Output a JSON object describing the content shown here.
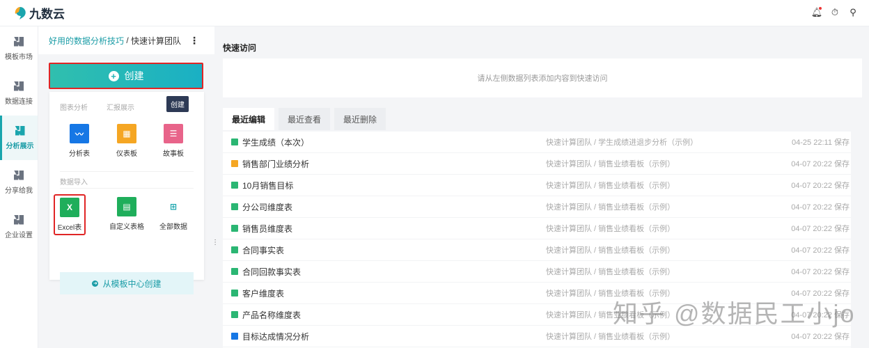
{
  "app": {
    "name": "九数云"
  },
  "header": {
    "icons": [
      "bell-icon",
      "timer-icon",
      "user-icon"
    ]
  },
  "nav": [
    {
      "label": "模板市场"
    },
    {
      "label": "数据连接"
    },
    {
      "label": "分析展示",
      "active": true
    },
    {
      "label": "分享给我"
    },
    {
      "label": "企业设置"
    }
  ],
  "panel": {
    "breadcrumb": {
      "parent": "好用的数据分析技巧",
      "sep": " / ",
      "current": "快速计算团队"
    },
    "create_label": "创建",
    "tooltip": "创建",
    "sections": {
      "chart": "图表分析",
      "report": "汇报展示",
      "import": "数据导入"
    },
    "tiles": [
      {
        "label": "分析表",
        "color": "#1677e5"
      },
      {
        "label": "仪表板",
        "color": "#f5a623"
      },
      {
        "label": "故事板",
        "color": "#e8648a"
      }
    ],
    "import_tiles": [
      {
        "label": "Excel表",
        "icon_text": "X"
      },
      {
        "label": "自定义表格"
      },
      {
        "label": "全部数据"
      }
    ],
    "template_button": "从模板中心创建"
  },
  "main": {
    "quick_title": "快速访问",
    "quick_placeholder": "请从左侧数据列表添加内容到快速访问",
    "tabs": [
      "最近编辑",
      "最近查看",
      "最近删除"
    ],
    "rows": [
      {
        "name": "学生成绩（本次）",
        "path": "快速计算团队 / 学生成绩进退步分析（示例）",
        "time": "04-25 22:11 保存",
        "type": "table"
      },
      {
        "name": "销售部门业绩分析",
        "path": "快速计算团队 / 销售业绩看板（示例）",
        "time": "04-07 20:22 保存",
        "type": "dashboard"
      },
      {
        "name": "10月销售目标",
        "path": "快速计算团队 / 销售业绩看板（示例）",
        "time": "04-07 20:22 保存",
        "type": "table"
      },
      {
        "name": "分公司维度表",
        "path": "快速计算团队 / 销售业绩看板（示例）",
        "time": "04-07 20:22 保存",
        "type": "table"
      },
      {
        "name": "销售员维度表",
        "path": "快速计算团队 / 销售业绩看板（示例）",
        "time": "04-07 20:22 保存",
        "type": "table"
      },
      {
        "name": "合同事实表",
        "path": "快速计算团队 / 销售业绩看板（示例）",
        "time": "04-07 20:22 保存",
        "type": "table"
      },
      {
        "name": "合同回款事实表",
        "path": "快速计算团队 / 销售业绩看板（示例）",
        "time": "04-07 20:22 保存",
        "type": "table"
      },
      {
        "name": "客户维度表",
        "path": "快速计算团队 / 销售业绩看板（示例）",
        "time": "04-07 20:22 保存",
        "type": "table"
      },
      {
        "name": "产品名称维度表",
        "path": "快速计算团队 / 销售业绩看板（示例）",
        "time": "04-07 20:22 保存",
        "type": "table"
      },
      {
        "name": "目标达成情况分析",
        "path": "快速计算团队 / 销售业绩看板（示例）",
        "time": "04-07 20:22 保存",
        "type": "analysis"
      }
    ]
  },
  "watermark": "知乎 @数据民工小jo",
  "colors": {
    "accent": "#1aa5ad",
    "table": "#2bb673",
    "dashboard": "#f5a623",
    "analysis": "#1677e5"
  }
}
